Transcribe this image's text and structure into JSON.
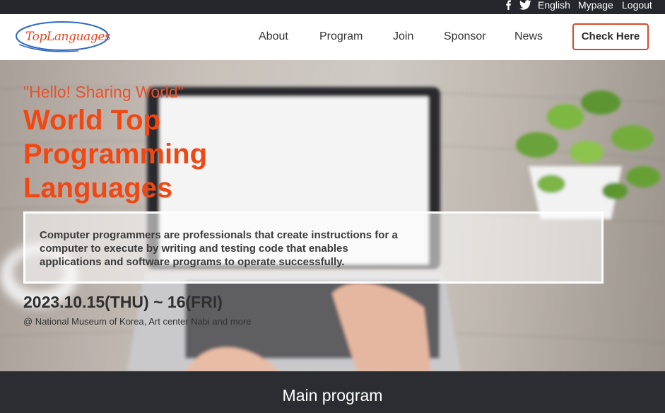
{
  "topbar": {
    "social": [
      {
        "icon": "facebook-icon",
        "label": "f"
      },
      {
        "icon": "twitter-icon",
        "label": "t"
      }
    ],
    "language": "English",
    "mypage": "Mypage",
    "logout": "Logout"
  },
  "header": {
    "logo_text": "TopLanguages",
    "nav": [
      "About",
      "Program",
      "Join",
      "Sponsor",
      "News"
    ],
    "cta": "Check Here"
  },
  "hero": {
    "tagline": "\"Hello! Sharing World\"",
    "title": "World Top Programming Languages",
    "description": "Computer programmers are professionals that create instructions for a computer to execute by writing and testing code that enables applications and software programs to operate successfully.",
    "date": "2023.10.15(THU) ~ 16(FRI)",
    "venue": "@ National Museum of Korea, Art center Nabi and more"
  },
  "section": {
    "heading": "Main program"
  },
  "colors": {
    "accent": "#f04713",
    "topbar": "#25272d",
    "band": "#2b2d33"
  }
}
